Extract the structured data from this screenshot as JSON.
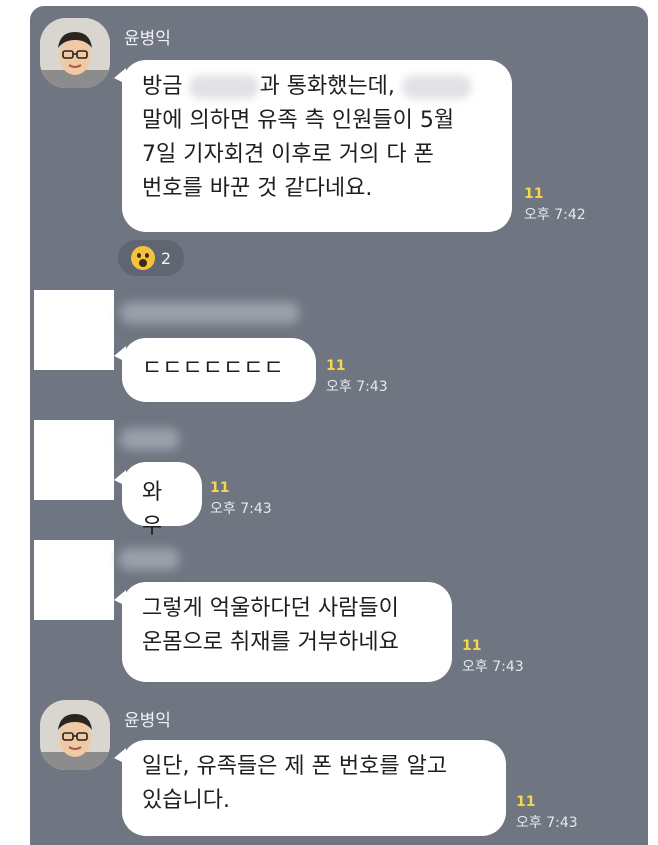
{
  "messages": [
    {
      "sender": "윤병익",
      "line1_a": "방금 ",
      "line1_b": "과 통화했는데,",
      "line2": "말에 의하면 유족 측 인원들이 5월",
      "line3": "7일 기자회견 이후로 거의 다 폰",
      "line4": "번호를 바꾼 것 같다네요.",
      "unread": "11",
      "time": "오후 7:42",
      "reaction": {
        "icon": "surprised-face-emoji",
        "count": "2"
      }
    },
    {
      "text": "ㄷㄷㄷㄷㄷㄷㄷ",
      "unread": "11",
      "time": "오후 7:43"
    },
    {
      "text": "와우",
      "unread": "11",
      "time": "오후 7:43"
    },
    {
      "line1": "그렇게 억울하다던 사람들이",
      "line2": "온몸으로 취재를 거부하네요",
      "unread": "11",
      "time": "오후 7:43"
    },
    {
      "sender": "윤병익",
      "line1": "일단, 유족들은 제 폰 번호를 알고",
      "line2": "있습니다.",
      "unread": "11",
      "time": "오후 7:43"
    }
  ],
  "colors": {
    "chat_bg": "#6f7581",
    "bubble": "#ffffff",
    "unread": "#f6d64a"
  }
}
